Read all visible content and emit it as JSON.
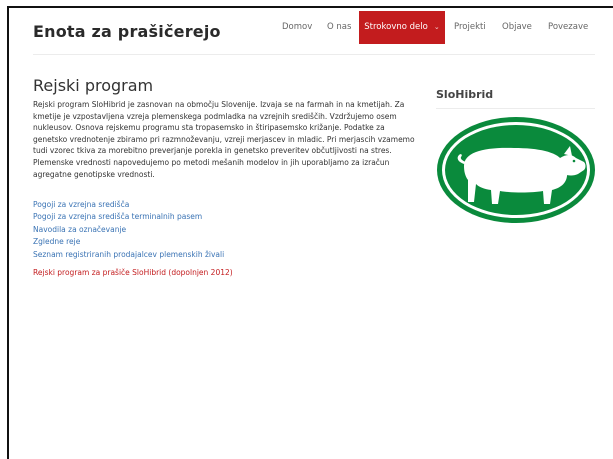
{
  "site": {
    "title": "Enota za prašičerejo"
  },
  "nav": {
    "items": [
      {
        "label": "Domov"
      },
      {
        "label": "O nas"
      },
      {
        "label": "Strokovno delo",
        "caret": "⌄"
      },
      {
        "label": "Projekti"
      },
      {
        "label": "Objave"
      },
      {
        "label": "Povezave"
      }
    ],
    "active_color": "#c31c1e"
  },
  "main": {
    "heading": "Rejski program",
    "intro": "Rejski program SloHibrid je zasnovan na območju Slovenije. Izvaja se na farmah in na kmetijah. Za kmetije je vzpostavljena vzreja plemenskega podmladka na vzrejnih središčih. Vzdržujemo osem nukleusov. Osnova rejskemu programu sta tropasemsko in štiripasemsko križanje. Podatke za genetsko vrednotenje zbiramo pri razmnoževanju, vzreji merjascev in mladic. Pri merjascih vzamemo tudi vzorec tkiva za morebitno preverjanje porekla in genetsko preveritev občutljivosti na stres. Plemenske vrednosti napovedujemo po metodi mešanih modelov in jih uporabljamo za izračun agregatne genotipske vrednosti.",
    "links": [
      "Pogoji za vzrejna središča",
      "Pogoji za vzrejna središča terminalnih pasem",
      "Navodila za označevanje",
      "Zgledne reje",
      "Seznam registriranih prodajalcev plemenskih živali"
    ],
    "highlight_link": "Rejski program za prašiče SloHibrid (dopolnjen 2012)",
    "link_color": "#3a73b4",
    "highlight_color": "#c31c1e"
  },
  "sidebar": {
    "heading": "SloHibrid",
    "logo_icon": "pig-logo-icon",
    "logo_color": "#0a8a3c"
  }
}
